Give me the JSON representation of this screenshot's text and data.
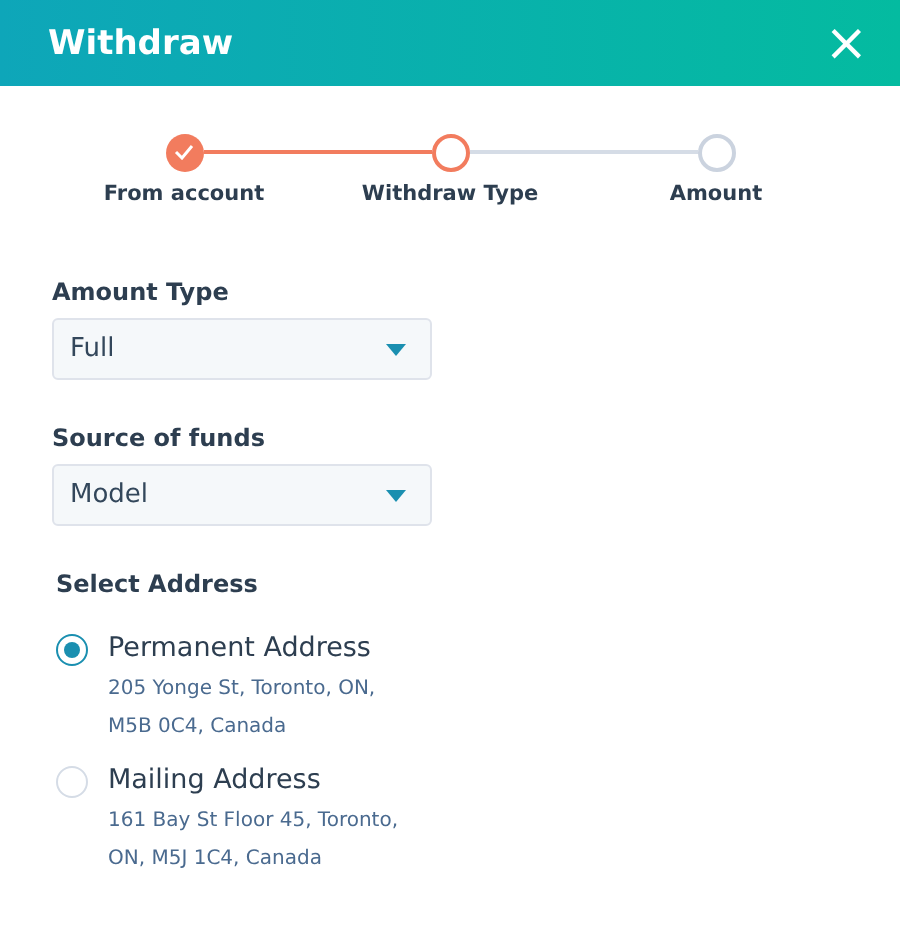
{
  "window": {
    "title": "Withdraw",
    "close": "×"
  },
  "steps": [
    {
      "label": "From account",
      "kind": "done"
    },
    {
      "label": "Withdraw Type",
      "kind": "current"
    },
    {
      "label": "Amount",
      "kind": "todo"
    }
  ],
  "fields": [
    {
      "label": "Amount Type",
      "value": "Full"
    },
    {
      "label": "Source of funds",
      "value": "Model"
    }
  ],
  "address_section": {
    "title": "Select Address",
    "options": [
      {
        "name": "Permanent Address",
        "address": "205 Yonge St, Toronto, ON, M5B 0C4, Canada",
        "selected": true
      },
      {
        "name": "Mailing Address",
        "address": "161 Bay St Floor 45, Toronto, ON, M5J 1C4, Canada",
        "selected": false
      }
    ]
  }
}
